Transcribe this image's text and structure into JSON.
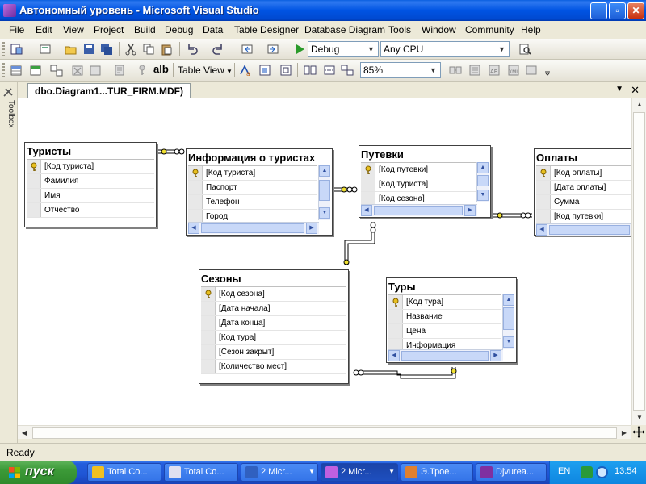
{
  "window": {
    "title": "Автономный уровень - Microsoft Visual Studio",
    "controls": [
      "_",
      "▫",
      "✕"
    ]
  },
  "menu": [
    "File",
    "Edit",
    "View",
    "Project",
    "Build",
    "Debug",
    "Data",
    "Table Designer",
    "Database Diagram",
    "Tools",
    "Window",
    "Community",
    "Help"
  ],
  "toolbar1": {
    "config": "Debug",
    "platform": "Any CPU"
  },
  "toolbar2": {
    "view_mode": "Table View",
    "zoom": "85%",
    "alb_label": "alb"
  },
  "toolbox": {
    "label": "Toolbox"
  },
  "document": {
    "tab": "dbo.Diagram1...TUR_FIRM.MDF)"
  },
  "tables": {
    "turisty": {
      "title": "Туристы",
      "rows": [
        "[Код туриста]",
        "Фамилия",
        "Имя",
        "Отчество"
      ]
    },
    "info": {
      "title": "Информация о туристах",
      "rows": [
        "[Код туриста]",
        "Паспорт",
        "Телефон",
        "Город"
      ]
    },
    "putevki": {
      "title": "Путевки",
      "rows": [
        "[Код путевки]",
        "[Код туриста]",
        "[Код сезона]"
      ]
    },
    "oplaty": {
      "title": "Оплаты",
      "rows": [
        "[Код оплаты]",
        "[Дата оплаты]",
        "Сумма",
        "[Код путевки]"
      ]
    },
    "sezony": {
      "title": "Сезоны",
      "rows": [
        "[Код сезона]",
        "[Дата начала]",
        "[Дата конца]",
        "[Код тура]",
        "[Сезон закрыт]",
        "[Количество мест]"
      ]
    },
    "tury": {
      "title": "Туры",
      "rows": [
        "[Код тура]",
        "Название",
        "Цена",
        "Информация"
      ]
    }
  },
  "status": "Ready",
  "taskbar": {
    "start": "пуск",
    "tasks": [
      {
        "label": "Total Co...",
        "icon_color": "#F0C020"
      },
      {
        "label": "Total Co...",
        "icon_color": "#E0E0F0"
      },
      {
        "label": "2 Micr...",
        "icon_color": "#3060C0"
      },
      {
        "label": "2 Micr...",
        "icon_color": "#C060E0"
      },
      {
        "label": "Э.Трое...",
        "icon_color": "#E08030"
      },
      {
        "label": "Djvurea...",
        "icon_color": "#8030A0"
      }
    ],
    "lang": "EN",
    "clock": "13:54"
  }
}
